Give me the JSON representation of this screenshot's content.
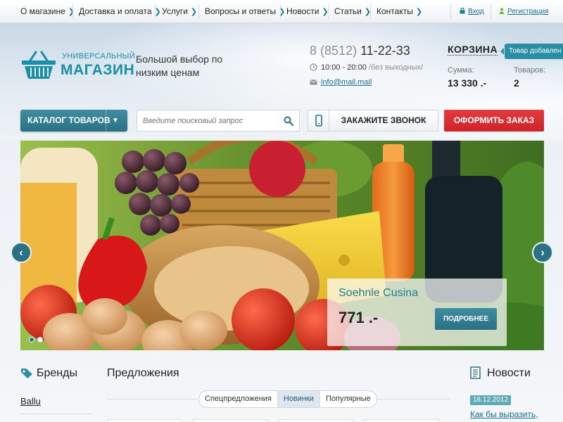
{
  "topnav": {
    "items": [
      {
        "label": "О магазине"
      },
      {
        "label": "Доставка и оплата"
      },
      {
        "label": "Услуги"
      },
      {
        "label": "Вопросы и ответы"
      },
      {
        "label": "Новости"
      },
      {
        "label": "Статьи"
      },
      {
        "label": "Контакты"
      }
    ],
    "login": "Вход",
    "register": "Регистрация"
  },
  "header": {
    "logo_small": "УНИВЕРСАЛЬНЫЙ",
    "logo_big": "МАГАЗИН",
    "slogan": "Большой выбор по низким ценам",
    "phone_code": "8 (8512)",
    "phone_number": "11-22-33",
    "hours": "10:00 - 20:00",
    "hours_extra": "/без выходных/",
    "email": "info@mail.mail"
  },
  "cart": {
    "title": "КОРЗИНА",
    "tooltip": "Товар добавлен",
    "sum_label": "Сумма:",
    "sum_value": "13 330 .-",
    "items_label": "Товаров:",
    "items_value": "2"
  },
  "toolbar": {
    "catalog_label": "КАТАЛОГ ТОВАРОВ",
    "search_placeholder": "Введите поисковый запрос",
    "call_label": "ЗАКАЖИТЕ ЗВОНОК",
    "order_label": "ОФОРМИТЬ ЗАКАЗ"
  },
  "slider": {
    "product_name": "Soehnle Cusina",
    "price": "771 .-",
    "more_label": "ПОДРОБНЕЕ",
    "slide_count": 2,
    "active_slide": 1
  },
  "brands": {
    "title": "Бренды",
    "items": [
      "Ballu"
    ]
  },
  "offers": {
    "title": "Предложения",
    "tabs": [
      {
        "label": "Спецпредложения",
        "active": false
      },
      {
        "label": "Новинки",
        "active": true
      },
      {
        "label": "Популярные",
        "active": false
      }
    ]
  },
  "news": {
    "title": "Новости",
    "items": [
      {
        "date": "18.12.2012",
        "title": "Как бы выразить,"
      }
    ]
  },
  "colors": {
    "accent": "#1a90a8",
    "button_teal": "#2a7185",
    "order_red": "#d9292e",
    "link": "#1a6e99"
  }
}
